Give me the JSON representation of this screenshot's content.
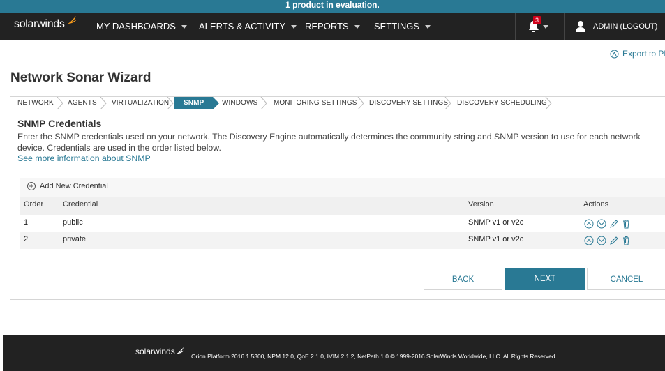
{
  "banner": {
    "text": "1 product in evaluation."
  },
  "brand": {
    "name": "solarwinds"
  },
  "nav": {
    "items": [
      {
        "label": "MY DASHBOARDS"
      },
      {
        "label": "ALERTS & ACTIVITY"
      },
      {
        "label": "REPORTS"
      },
      {
        "label": "SETTINGS"
      }
    ],
    "notification_count": "3",
    "user_label": "ADMIN (LOGOUT)"
  },
  "export": {
    "label": "Export to PDF"
  },
  "page": {
    "title": "Network Sonar Wizard"
  },
  "steps": [
    {
      "label": "NETWORK"
    },
    {
      "label": "AGENTS"
    },
    {
      "label": "VIRTUALIZATION"
    },
    {
      "label": "SNMP"
    },
    {
      "label": "WINDOWS"
    },
    {
      "label": "MONITORING SETTINGS"
    },
    {
      "label": "DISCOVERY SETTINGS"
    },
    {
      "label": "DISCOVERY SCHEDULING"
    }
  ],
  "snmp": {
    "title": "SNMP Credentials",
    "description": "Enter the SNMP credentials used on your network. The Discovery Engine automatically determines the community string and SNMP version to use for each network device. Credentials are used in the order listed below.",
    "more_link": "See more information about SNMP",
    "add_label": "Add New Credential",
    "columns": {
      "order": "Order",
      "credential": "Credential",
      "version": "Version",
      "actions": "Actions"
    },
    "rows": [
      {
        "order": "1",
        "credential": "public",
        "version": "SNMP v1 or v2c"
      },
      {
        "order": "2",
        "credential": "private",
        "version": "SNMP v1 or v2c"
      }
    ]
  },
  "buttons": {
    "back": "BACK",
    "next": "NEXT",
    "cancel": "CANCEL"
  },
  "footer": {
    "text": "Orion Platform 2016.1.5300, NPM 12.0, QoE 2.1.0, IVIM 2.1.2, NetPath 1.0 © 1999-2016 SolarWinds Worldwide, LLC. All Rights Reserved."
  },
  "colors": {
    "accent": "#297994",
    "nav_bg": "#222222",
    "badge": "#d0021b",
    "flame": "#f99d1c"
  }
}
